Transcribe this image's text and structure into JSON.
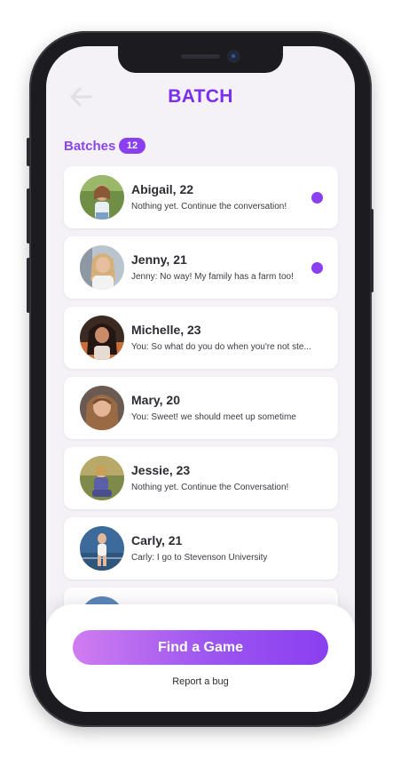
{
  "header": {
    "title": "BATCH",
    "back_icon": "arrow-left-icon"
  },
  "batches": {
    "label": "Batches",
    "count": "12"
  },
  "chats": [
    {
      "name": "Abigail, 22",
      "preview": "Nothing yet. Continue the conversation!",
      "unread": true
    },
    {
      "name": "Jenny, 21",
      "preview": "Jenny: No way! My family has a farm too!",
      "unread": true
    },
    {
      "name": "Michelle, 23",
      "preview": "You: So what do you do when you're not ste...",
      "unread": false
    },
    {
      "name": "Mary, 20",
      "preview": "You: Sweet! we should meet up sometime",
      "unread": false
    },
    {
      "name": "Jessie, 23",
      "preview": "Nothing yet. Continue the Conversation!",
      "unread": false
    },
    {
      "name": "Carly, 21",
      "preview": "Carly: I go to Stevenson University",
      "unread": false
    }
  ],
  "footer": {
    "primary_button": "Find a Game",
    "secondary_link": "Report a bug"
  },
  "colors": {
    "accent": "#8a3ff0",
    "title": "#7a2ff0",
    "background": "#f4f2f6"
  }
}
